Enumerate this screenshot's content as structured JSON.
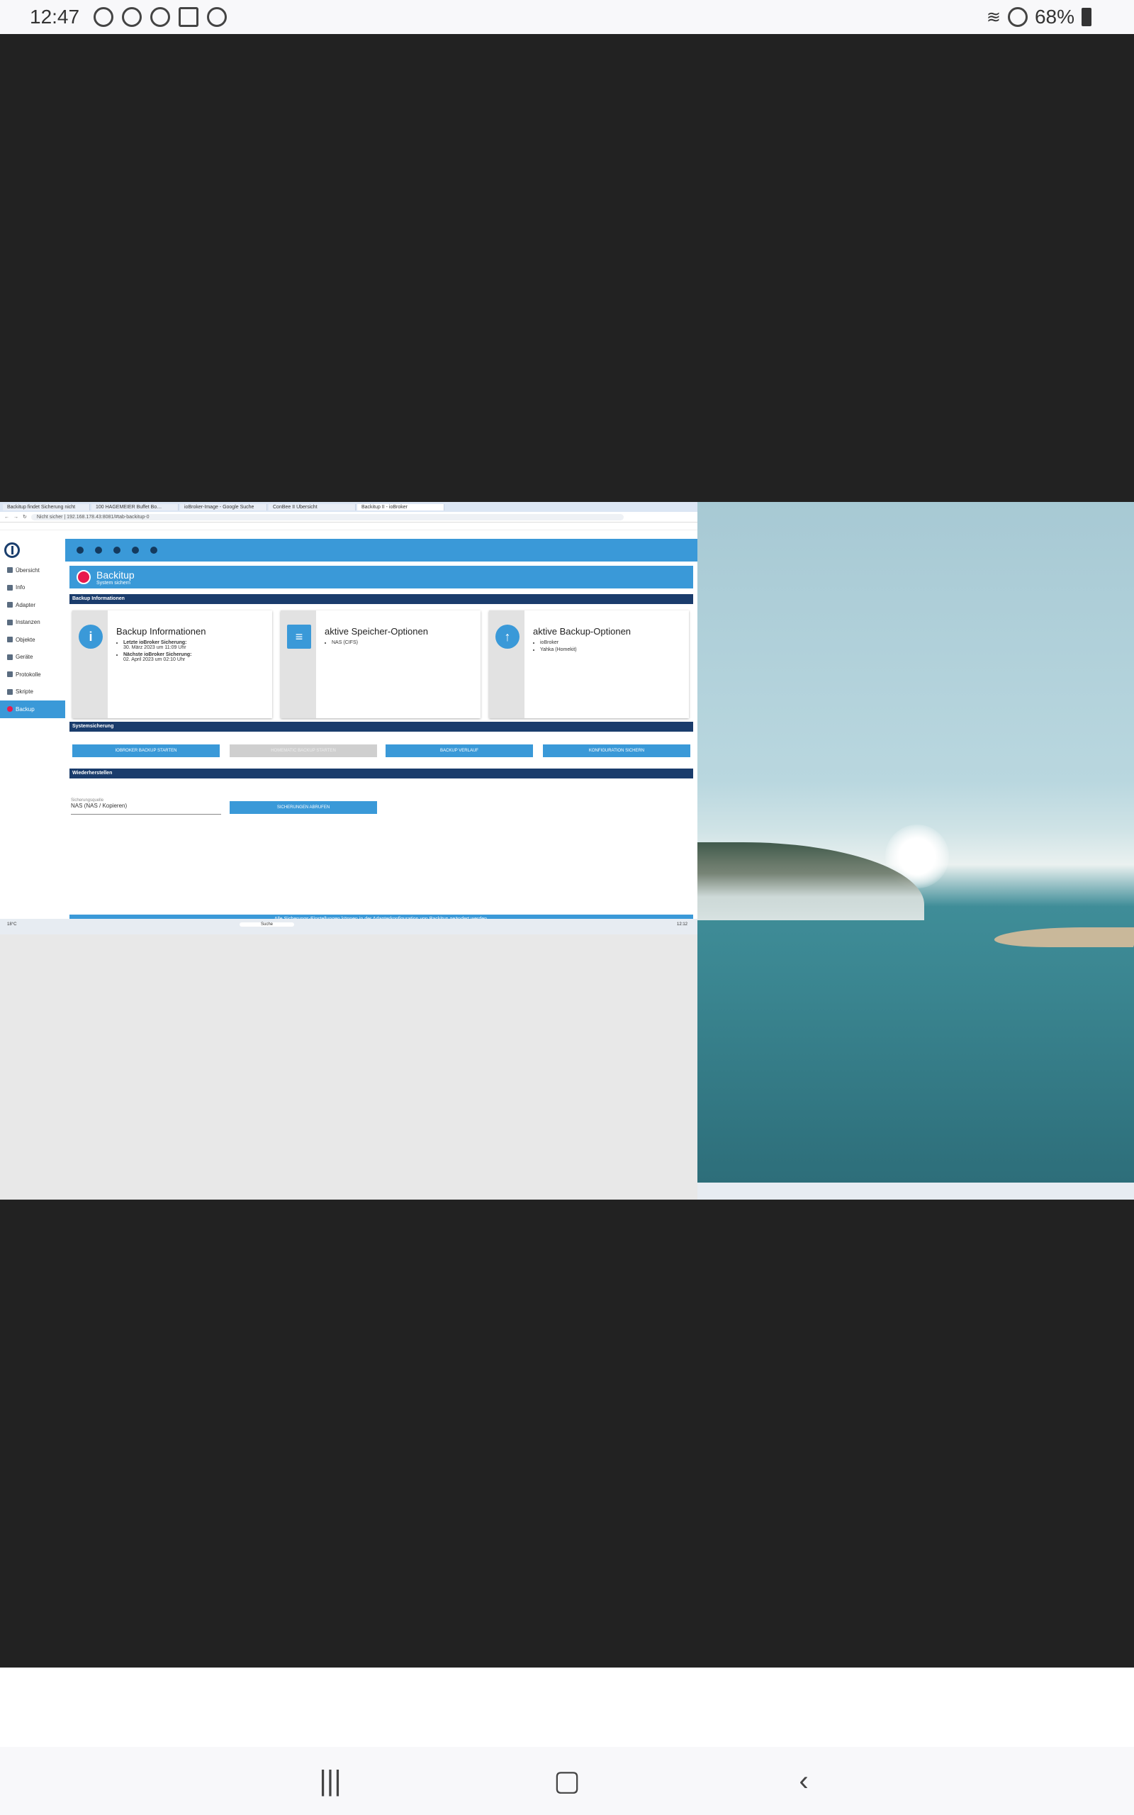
{
  "status_bar": {
    "time": "12:47",
    "battery": "68%"
  },
  "browser": {
    "tabs": [
      "Backitup findet Sicherung nicht",
      "100 HAGEMEIER Buffet Bo…",
      "ioBroker-Image - Google Suche",
      "ConBee II Übersicht",
      "Backitup II - ioBroker"
    ],
    "url": "Nicht sicher  |  192.168.178.43:8081/#tab-backitup-0"
  },
  "sidebar": {
    "items": [
      {
        "label": "Übersicht"
      },
      {
        "label": "Info"
      },
      {
        "label": "Adapter"
      },
      {
        "label": "Instanzen"
      },
      {
        "label": "Objekte"
      },
      {
        "label": "Geräte"
      },
      {
        "label": "Protokolle"
      },
      {
        "label": "Skripte"
      },
      {
        "label": "Backup"
      }
    ]
  },
  "header": {
    "title": "Backitup",
    "subtitle": "System sichern"
  },
  "sections": {
    "info": "Backup Informationen",
    "system": "Systemsicherung",
    "restore": "Wiederherstellen"
  },
  "cards": [
    {
      "title": "Backup Informationen",
      "lines": [
        "Letzte ioBroker Sicherung:",
        "30. März 2023 um 11:09 Uhr",
        "Nächste ioBroker Sicherung:",
        "02. April 2023 um 02:10 Uhr"
      ]
    },
    {
      "title": "aktive Speicher-Optionen",
      "lines": [
        "NAS (CIFS)"
      ]
    },
    {
      "title": "aktive Backup-Optionen",
      "lines": [
        "ioBroker",
        "Yahka (Homekit)"
      ]
    }
  ],
  "buttons": {
    "iobroker": "IOBROKER BACKUP STARTEN",
    "homematic": "HOMEMATIC BACKUP STARTEN",
    "history": "BACKUP VERLAUF",
    "config": "KONFIGURATION SICHERN",
    "restore_fetch": "SICHERUNGEN ABRUFEN"
  },
  "restore": {
    "source_label": "Sicherungsquelle",
    "source_value": "NAS (NAS / Kopieren)"
  },
  "footer": "Alle Sicherungs-Einstellungen können in der Adapterkonfiguration von Backitup geändert werden.",
  "taskbar": {
    "weather": "18°C",
    "search": "Suche",
    "clock": "12:12"
  }
}
